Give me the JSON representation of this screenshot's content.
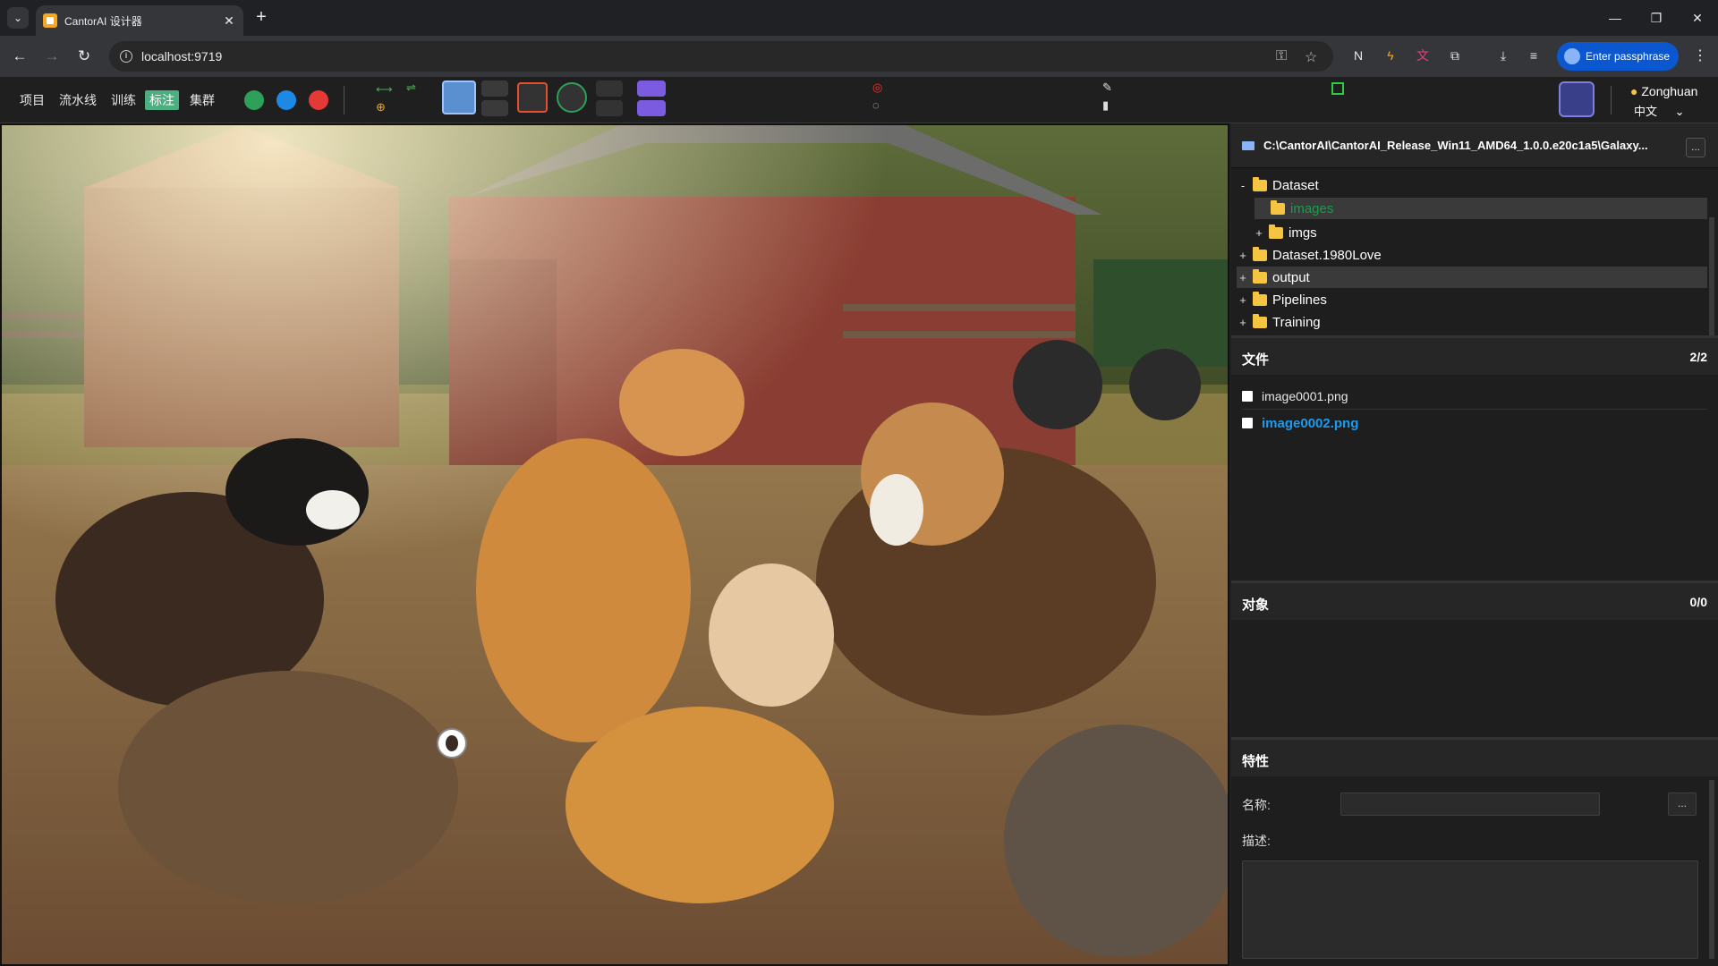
{
  "browser": {
    "tab_title": "CantorAI 设计器",
    "url": "localhost:9719",
    "passphrase_label": "Enter passphrase"
  },
  "toolbar": {
    "menu": [
      "项目",
      "流水线",
      "训练",
      "标注",
      "集群"
    ],
    "active_menu": "标注",
    "user_name": "Zonghuan",
    "language": "中文"
  },
  "sidebar": {
    "path": "C:\\CantorAI\\CantorAI_Release_Win11_AMD64_1.0.0.e20c1a5\\Galaxy...",
    "path_more": "...",
    "tree": [
      {
        "expander": "-",
        "label": "Dataset"
      },
      {
        "expander": "",
        "label": "images"
      },
      {
        "expander": "+",
        "label": "imgs"
      },
      {
        "expander": "+",
        "label": "Dataset.1980Love"
      },
      {
        "expander": "+",
        "label": "output"
      },
      {
        "expander": "+",
        "label": "Pipelines"
      },
      {
        "expander": "+",
        "label": "Training"
      }
    ],
    "files_title": "文件",
    "files_count": "2/2",
    "files": [
      "image0001.png",
      "image0002.png"
    ],
    "objects_title": "对象",
    "objects_count": "0/0",
    "props_title": "特性",
    "name_label": "名称:",
    "name_more": "...",
    "desc_label": "描述:"
  },
  "colors": {
    "active_menu_bg": "#4caf80",
    "selected_file": "#1a9bf0",
    "selected_tree_label": "#13a04a",
    "folder": "#f5c542"
  }
}
